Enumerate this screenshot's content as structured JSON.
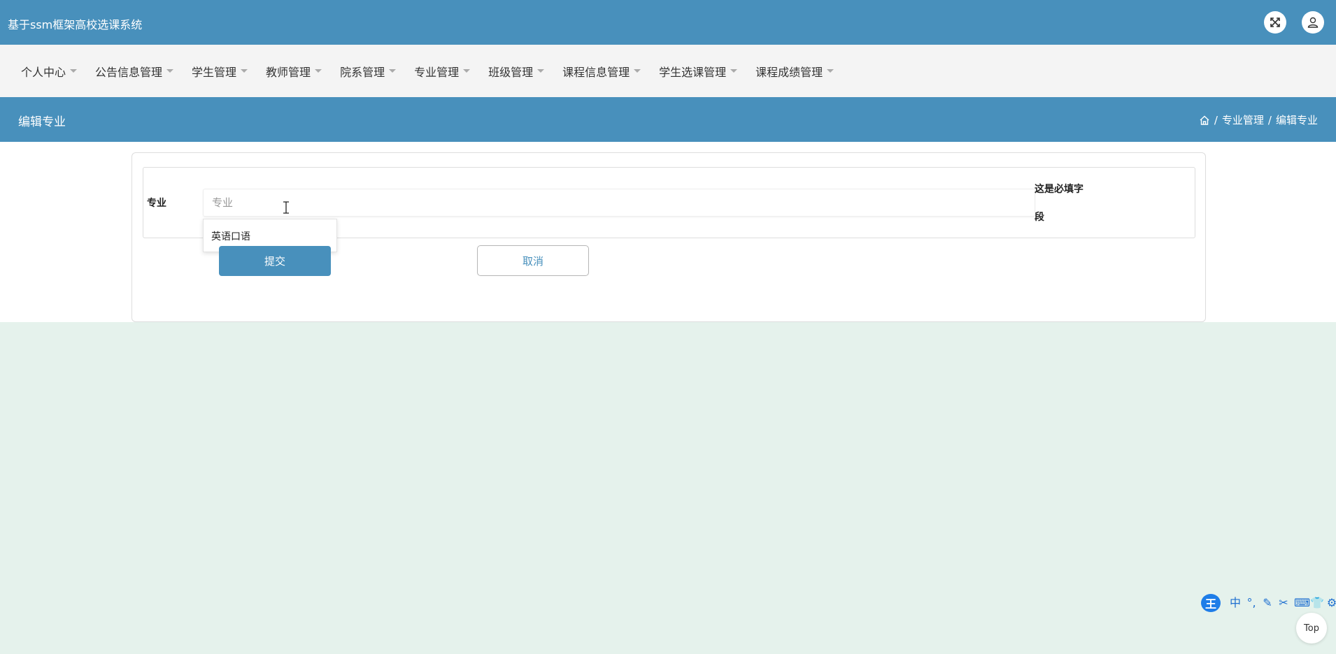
{
  "app": {
    "title": "基于ssm框架高校选课系统"
  },
  "topbar": {
    "fullscreen_icon": "expand-icon",
    "user_icon": "user-icon"
  },
  "nav": {
    "items": [
      {
        "label": "个人中心"
      },
      {
        "label": "公告信息管理"
      },
      {
        "label": "学生管理"
      },
      {
        "label": "教师管理"
      },
      {
        "label": "院系管理"
      },
      {
        "label": "专业管理"
      },
      {
        "label": "班级管理"
      },
      {
        "label": "课程信息管理"
      },
      {
        "label": "学生选课管理"
      },
      {
        "label": "课程成绩管理"
      }
    ]
  },
  "page": {
    "title": "编辑专业",
    "breadcrumb": {
      "home_icon": "home-icon",
      "sep": "/",
      "level1": "专业管理",
      "level2": "编辑专业"
    }
  },
  "form": {
    "label": "专业",
    "value": "",
    "placeholder": "专业",
    "required_line1": "这是必填字",
    "required_line2": "段",
    "autocomplete_option": "英语口语",
    "submit_label": "提交",
    "cancel_label": "取消"
  },
  "ime": {
    "logo": "王",
    "items": [
      "中",
      "°,",
      "✎",
      "✂",
      "⌨",
      "👕",
      "⚙"
    ]
  },
  "back_to_top": {
    "label": "Top"
  },
  "colors": {
    "primary": "#4890bc",
    "page_bg": "#e5f2ec",
    "nav_bg": "#f4f4f4",
    "ime_blue": "#1e7de8"
  }
}
